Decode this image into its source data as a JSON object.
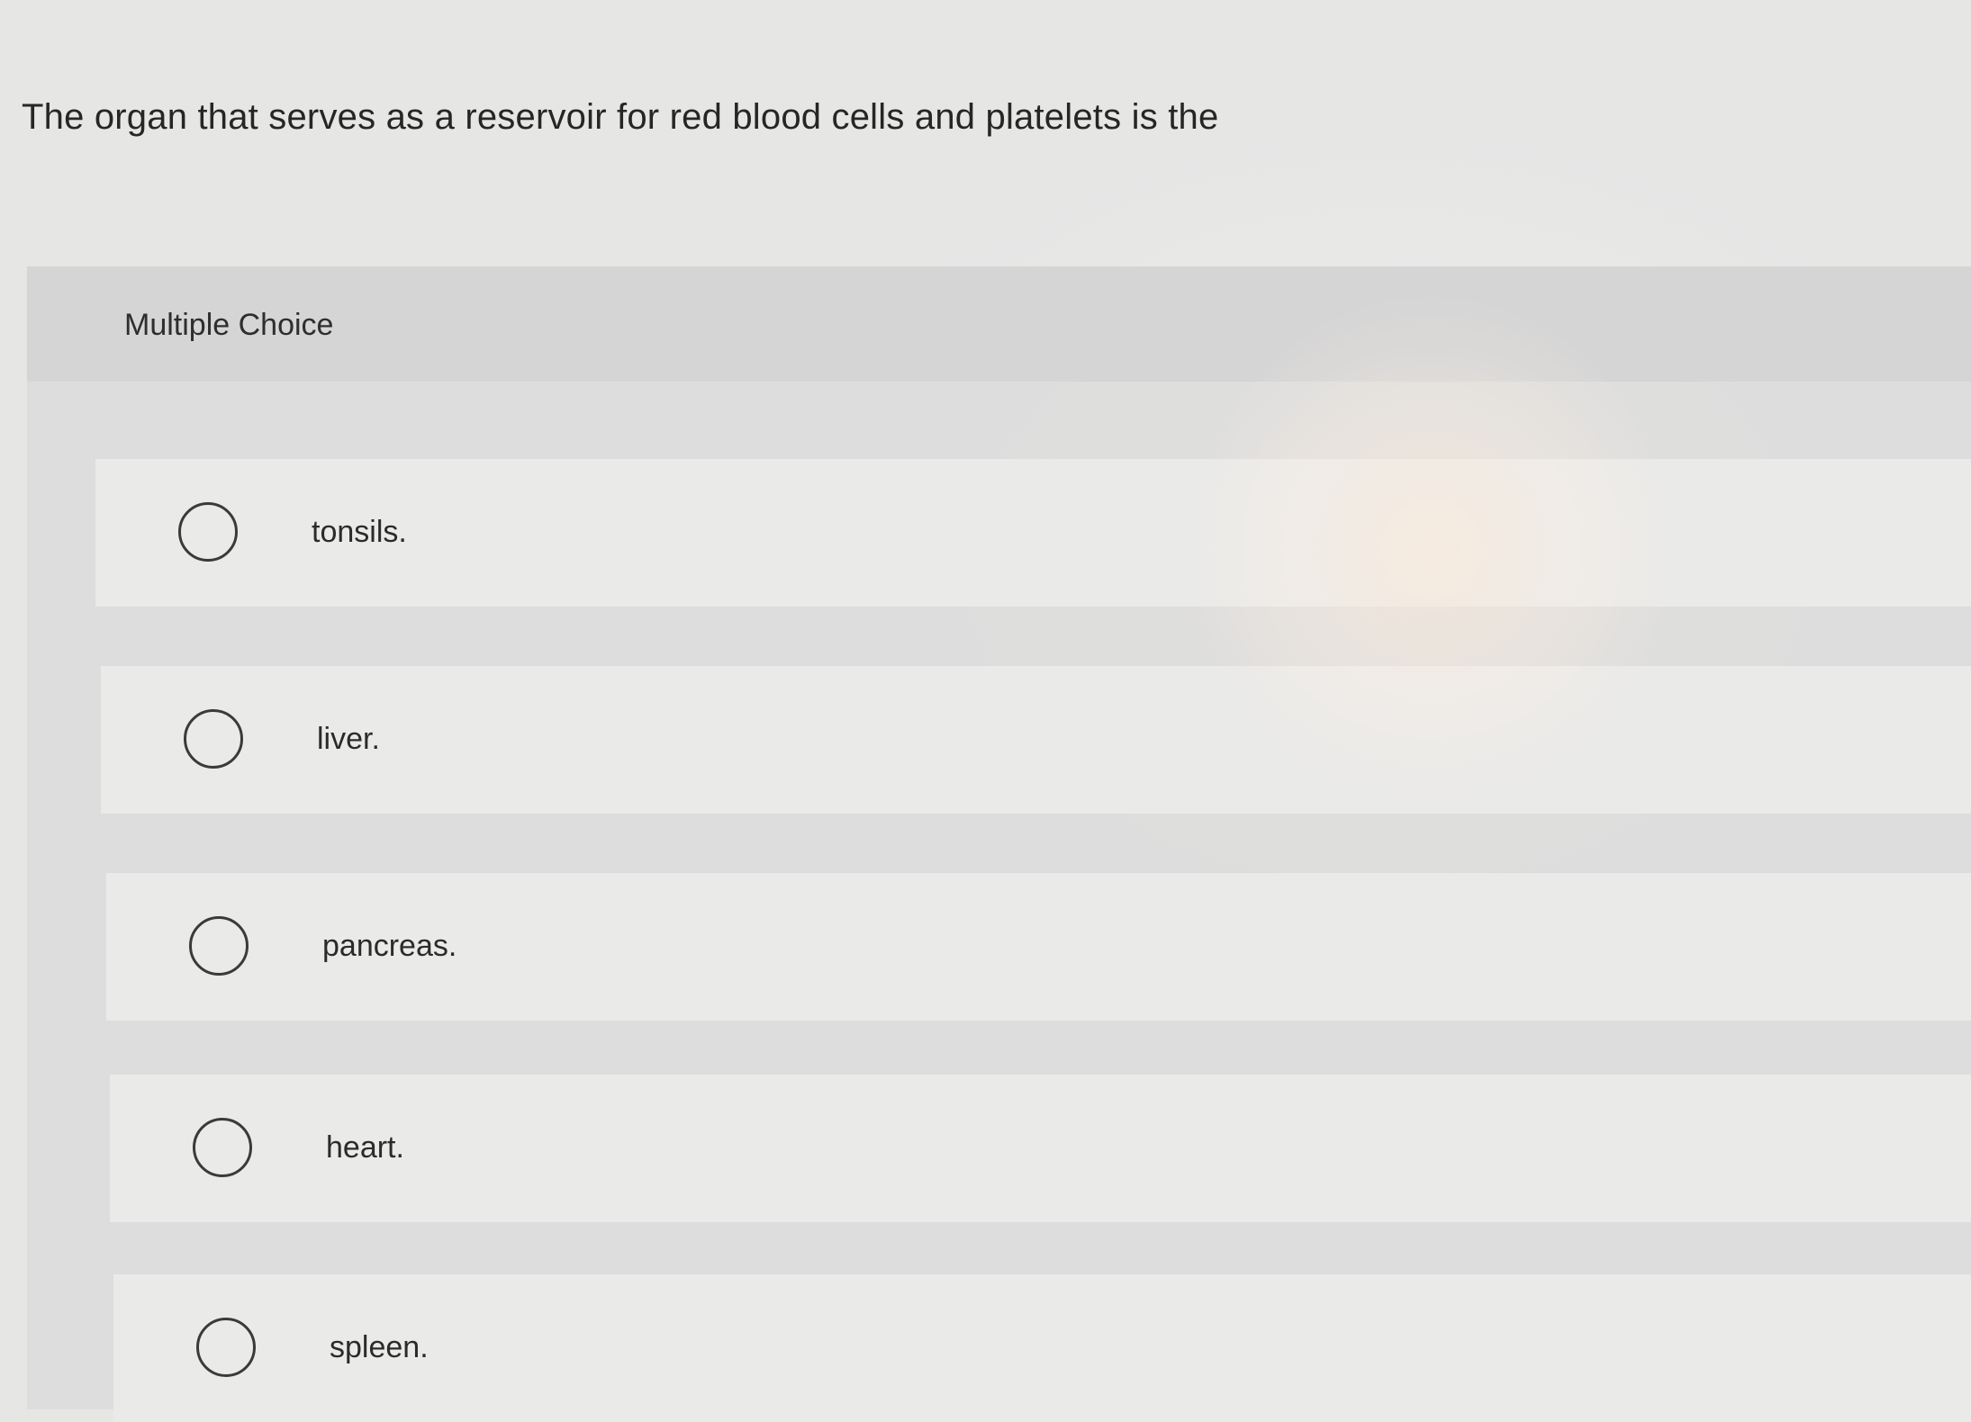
{
  "question": {
    "text": "The organ that serves as a reservoir for red blood cells and platelets is the"
  },
  "panel": {
    "title": "Multiple Choice"
  },
  "options": [
    {
      "label": "tonsils.",
      "selected": false
    },
    {
      "label": "liver.",
      "selected": false
    },
    {
      "label": "pancreas.",
      "selected": false
    },
    {
      "label": "heart.",
      "selected": false
    },
    {
      "label": "spleen.",
      "selected": false
    }
  ]
}
